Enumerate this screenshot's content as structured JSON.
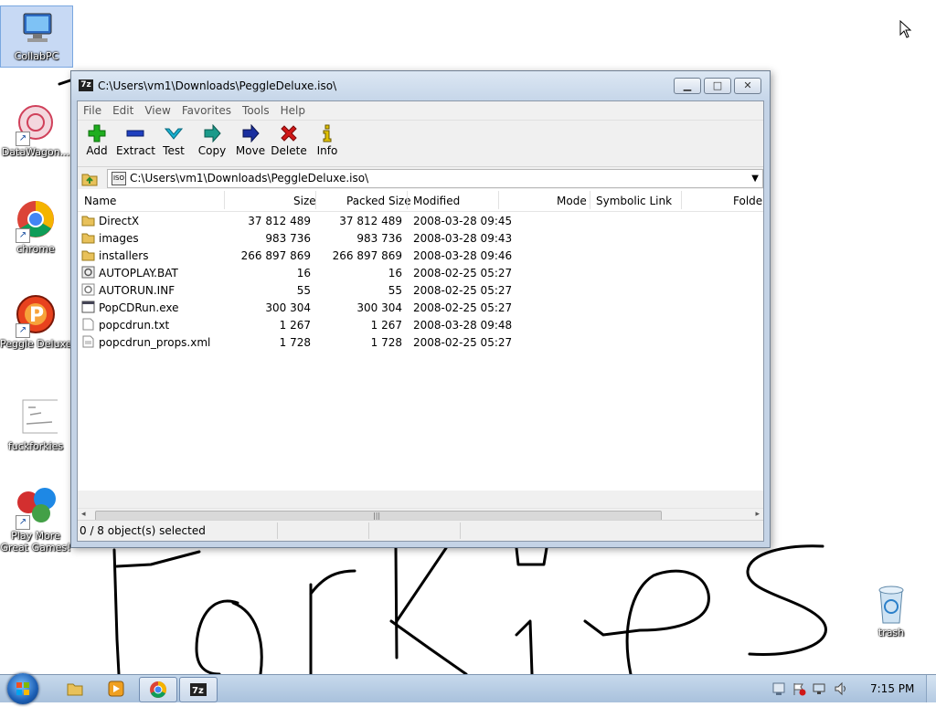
{
  "desktop": {
    "icons": [
      {
        "label": "CollabPC"
      },
      {
        "label": "DataWagon..."
      },
      {
        "label": "chrome"
      },
      {
        "label": "Peggle Deluxe"
      },
      {
        "label": "fuckforkies"
      },
      {
        "label": "Play More Great Games!"
      },
      {
        "label": "trash"
      }
    ]
  },
  "window": {
    "title": "C:\\Users\\vm1\\Downloads\\PeggleDeluxe.iso\\",
    "app_icon_text": "7z",
    "menu": [
      "File",
      "Edit",
      "View",
      "Favorites",
      "Tools",
      "Help"
    ],
    "toolbar": [
      {
        "label": "Add",
        "icon": "add-icon",
        "color": "#1fae1f"
      },
      {
        "label": "Extract",
        "icon": "extract-icon",
        "color": "#1f3fbf"
      },
      {
        "label": "Test",
        "icon": "test-icon",
        "color": "#18b0d0"
      },
      {
        "label": "Copy",
        "icon": "copy-icon",
        "color": "#1a9a8a"
      },
      {
        "label": "Move",
        "icon": "move-icon",
        "color": "#1a2f9f"
      },
      {
        "label": "Delete",
        "icon": "delete-icon",
        "color": "#d01818"
      },
      {
        "label": "Info",
        "icon": "info-icon",
        "color": "#e0c000"
      }
    ],
    "address": "C:\\Users\\vm1\\Downloads\\PeggleDeluxe.iso\\",
    "address_icon_text": "ISO",
    "columns": [
      "Name",
      "Size",
      "Packed Size",
      "Modified",
      "Mode",
      "Symbolic Link",
      "Folder"
    ],
    "files": [
      {
        "name": "DirectX",
        "size": "37 812 489",
        "packed": "37 812 489",
        "modified": "2008-03-28 09:45",
        "type": "folder"
      },
      {
        "name": "images",
        "size": "983 736",
        "packed": "983 736",
        "modified": "2008-03-28 09:43",
        "type": "folder"
      },
      {
        "name": "installers",
        "size": "266 897 869",
        "packed": "266 897 869",
        "modified": "2008-03-28 09:46",
        "type": "folder"
      },
      {
        "name": "AUTOPLAY.BAT",
        "size": "16",
        "packed": "16",
        "modified": "2008-02-25 05:27",
        "type": "bat"
      },
      {
        "name": "AUTORUN.INF",
        "size": "55",
        "packed": "55",
        "modified": "2008-02-25 05:27",
        "type": "inf"
      },
      {
        "name": "PopCDRun.exe",
        "size": "300 304",
        "packed": "300 304",
        "modified": "2008-02-25 05:27",
        "type": "exe"
      },
      {
        "name": "popcdrun.txt",
        "size": "1 267",
        "packed": "1 267",
        "modified": "2008-03-28 09:48",
        "type": "txt"
      },
      {
        "name": "popcdrun_props.xml",
        "size": "1 728",
        "packed": "1 728",
        "modified": "2008-02-25 05:27",
        "type": "xml"
      }
    ],
    "status": "0 / 8 object(s) selected"
  },
  "taskbar": {
    "clock": "7:15 PM"
  }
}
